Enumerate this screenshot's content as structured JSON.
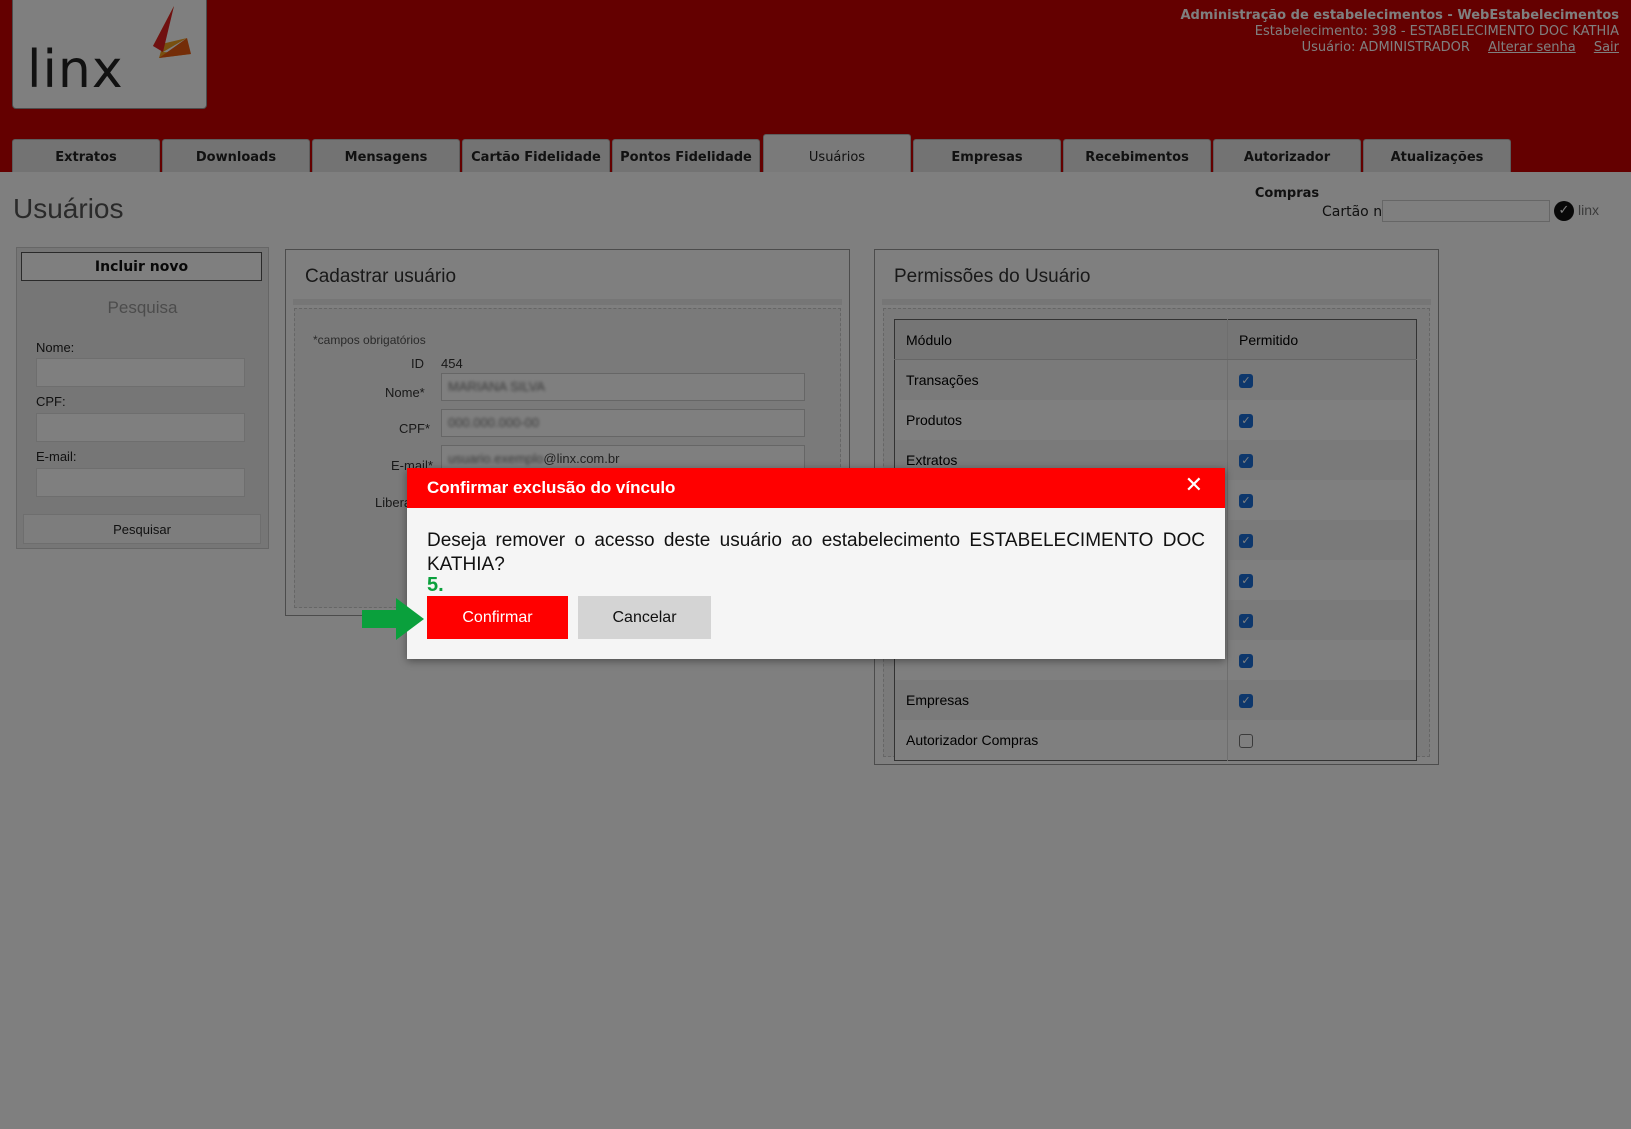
{
  "brand": {
    "logo_text": "linx",
    "accent": "#c80000",
    "modal_red": "#ff0000"
  },
  "topinfo": {
    "line1": "Administração de estabelecimentos - WebEstabelecimentos",
    "line2": "Estabelecimento: 398 - ESTABELECIMENTO DOC KATHIA",
    "user": "Usuário: ADMINISTRADOR",
    "change_password": "Alterar senha",
    "logout": "Sair"
  },
  "tabs": [
    {
      "label": "Extratos"
    },
    {
      "label": "Downloads"
    },
    {
      "label": "Mensagens"
    },
    {
      "label": "Cartão Fidelidade"
    },
    {
      "label": "Pontos Fidelidade"
    },
    {
      "label": "Usuários"
    },
    {
      "label": "Empresas"
    },
    {
      "label": "Recebimentos"
    },
    {
      "label": "Autorizador Compras"
    },
    {
      "label": "Atualizações"
    }
  ],
  "page_title": "Usuários",
  "card": {
    "label": "Cartão nº",
    "value": "",
    "logo": "linx"
  },
  "search": {
    "new_button": "Incluir novo",
    "title": "Pesquisa",
    "name_label": "Nome:",
    "cpf_label": "CPF:",
    "email_label": "E-mail:",
    "submit": "Pesquisar"
  },
  "cadastro": {
    "title": "Cadastrar usuário",
    "required_note": "*campos obrigatórios",
    "id_label": "ID",
    "id_value": "454",
    "name_label": "Nome*",
    "name_value": "MARIANA SILVA",
    "cpf_label": "CPF*",
    "cpf_value": "000.000.000-00",
    "email_label": "E-mail*",
    "email_user": "usuario.exemplo",
    "email_domain": "@linx.com.br",
    "liberado_label": "Libera"
  },
  "permissoes": {
    "title": "Permissões do Usuário",
    "col_module": "Módulo",
    "col_allowed": "Permitido",
    "rows": [
      {
        "module": "Transações",
        "allowed": true
      },
      {
        "module": "Produtos",
        "allowed": true
      },
      {
        "module": "Extratos",
        "allowed": true
      },
      {
        "module": "",
        "allowed": true
      },
      {
        "module": "",
        "allowed": true
      },
      {
        "module": "",
        "allowed": true
      },
      {
        "module": "",
        "allowed": true
      },
      {
        "module": "",
        "allowed": true
      },
      {
        "module": "Empresas",
        "allowed": true
      },
      {
        "module": "Autorizador Compras",
        "allowed": false
      }
    ]
  },
  "modal": {
    "title": "Confirmar exclusão do vínculo",
    "message": "Deseja remover o acesso deste usuário ao estabelecimento ESTABELECIMENTO DOC KATHIA?",
    "step": "5.",
    "confirm": "Confirmar",
    "cancel": "Cancelar",
    "arrow_color": "#0aa03c"
  }
}
